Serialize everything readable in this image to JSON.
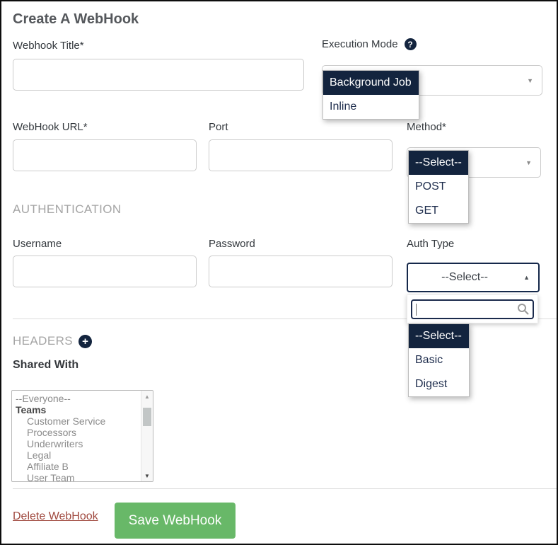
{
  "header": {
    "title": "Create A WebHook"
  },
  "form": {
    "webhook_title": {
      "label": "Webhook Title*",
      "value": ""
    },
    "execution_mode": {
      "label": "Execution Mode",
      "selected": "Background Job",
      "options": [
        "Background Job",
        "Inline"
      ]
    },
    "webhook_url": {
      "label": "WebHook URL*",
      "value": ""
    },
    "port": {
      "label": "Port",
      "value": ""
    },
    "method": {
      "label": "Method*",
      "display": "--Select--",
      "selected": "--Select--",
      "options": [
        "--Select--",
        "POST",
        "GET"
      ]
    },
    "username": {
      "label": "Username",
      "value": ""
    },
    "password": {
      "label": "Password",
      "value": ""
    },
    "auth_type": {
      "label": "Auth Type",
      "display": "--Select--",
      "selected": "--Select--",
      "search_value": "",
      "options": [
        "--Select--",
        "Basic",
        "Digest"
      ]
    }
  },
  "sections": {
    "authentication": "AUTHENTICATION",
    "headers": "HEADERS"
  },
  "shared_with": {
    "label": "Shared With",
    "items": [
      {
        "label": "--Everyone--"
      },
      {
        "label": "Teams"
      },
      {
        "label": "Customer Service"
      },
      {
        "label": "Processors"
      },
      {
        "label": "Underwriters"
      },
      {
        "label": "Legal"
      },
      {
        "label": "Affiliate B"
      },
      {
        "label": "User Team"
      }
    ]
  },
  "actions": {
    "delete_label": "Delete WebHook",
    "save_label": "Save WebHook"
  },
  "icons": {
    "help": "?",
    "add": "+",
    "caret_down": "▼",
    "caret_up": "▲",
    "scroll_up": "▲",
    "scroll_down": "▼"
  },
  "colors": {
    "navy_highlight": "#13243E",
    "save_green": "#68B868",
    "delete_red": "#A0493F",
    "divider_gray": "#DCDCDC",
    "section_gray": "#A4A4A4"
  }
}
